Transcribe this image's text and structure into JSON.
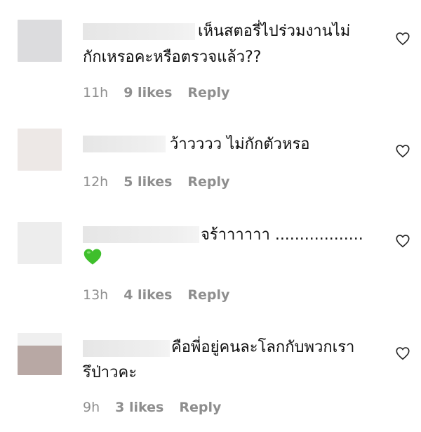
{
  "comments": [
    {
      "line1": "เห็นสตอรี่ไปร่วมงานไม่",
      "line2": "กักเหรอคะหรือตรวจแล้ว??",
      "time": "11h",
      "likes": "9 likes",
      "reply": "Reply",
      "avatar_color": "#dcdcde"
    },
    {
      "line1": "ว้าวววว ไม่กักตัวหรอ",
      "line2": "",
      "time": "12h",
      "likes": "5 likes",
      "reply": "Reply",
      "avatar_color": "#ede8e6"
    },
    {
      "line1": "จร้าาาาาา ..................",
      "line2": "",
      "time": "13h",
      "likes": "4 likes",
      "reply": "Reply",
      "avatar_color": "#ededed",
      "emoji": "green-heart"
    },
    {
      "line1": "คือพี่อยู่คนละโลกกับพวกเรา",
      "line2": "รึป่าวคะ",
      "time": "9h",
      "likes": "3 likes",
      "reply": "Reply",
      "avatar_color": "#b8a8a4"
    }
  ],
  "icons": {
    "like": "heart-outline-icon",
    "emoji": "green-heart-emoji"
  },
  "colors": {
    "meta_text": "#8e8e8e",
    "emoji_green": "#3fbf2c"
  }
}
